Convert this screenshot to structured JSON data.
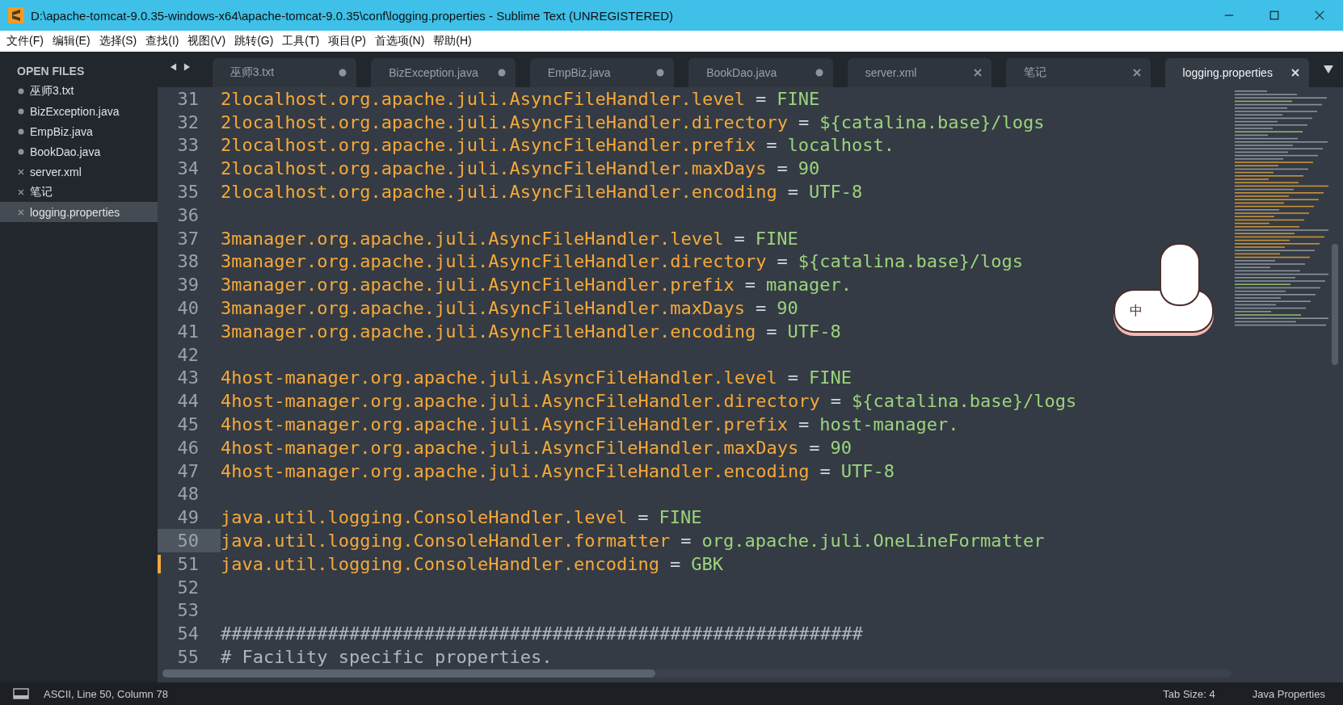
{
  "window": {
    "title": "D:\\apache-tomcat-9.0.35-windows-x64\\apache-tomcat-9.0.35\\conf\\logging.properties - Sublime Text (UNREGISTERED)"
  },
  "menu": [
    "文件(F)",
    "编辑(E)",
    "选择(S)",
    "查找(I)",
    "视图(V)",
    "跳转(G)",
    "工具(T)",
    "项目(P)",
    "首选项(N)",
    "帮助(H)"
  ],
  "sidebar": {
    "title": "OPEN FILES",
    "items": [
      {
        "label": "巫师3.txt",
        "dirty": true,
        "selected": false
      },
      {
        "label": "BizException.java",
        "dirty": true,
        "selected": false
      },
      {
        "label": "EmpBiz.java",
        "dirty": true,
        "selected": false
      },
      {
        "label": "BookDao.java",
        "dirty": true,
        "selected": false
      },
      {
        "label": "server.xml",
        "dirty": false,
        "selected": false
      },
      {
        "label": "笔记",
        "dirty": false,
        "selected": false
      },
      {
        "label": "logging.properties",
        "dirty": false,
        "selected": true
      }
    ]
  },
  "tabs": [
    {
      "label": "巫师3.txt",
      "dirty": true,
      "selected": false
    },
    {
      "label": "BizException.java",
      "dirty": true,
      "selected": false
    },
    {
      "label": "EmpBiz.java",
      "dirty": true,
      "selected": false
    },
    {
      "label": "BookDao.java",
      "dirty": true,
      "selected": false
    },
    {
      "label": "server.xml",
      "dirty": false,
      "selected": false
    },
    {
      "label": "笔记",
      "dirty": false,
      "selected": false
    },
    {
      "label": "logging.properties",
      "dirty": false,
      "selected": true
    }
  ],
  "editor": {
    "lines": [
      {
        "number": "31",
        "kind": "property",
        "key": "2localhost.org.apache.juli.AsyncFileHandler.level",
        "separator": "=",
        "value": "FINE",
        "current": false,
        "modified": false
      },
      {
        "number": "32",
        "kind": "property",
        "key": "2localhost.org.apache.juli.AsyncFileHandler.directory",
        "separator": "=",
        "value": "${catalina.base}/logs",
        "current": false,
        "modified": false
      },
      {
        "number": "33",
        "kind": "property",
        "key": "2localhost.org.apache.juli.AsyncFileHandler.prefix",
        "separator": "=",
        "value": "localhost.",
        "current": false,
        "modified": false
      },
      {
        "number": "34",
        "kind": "property",
        "key": "2localhost.org.apache.juli.AsyncFileHandler.maxDays",
        "separator": "=",
        "value": "90",
        "current": false,
        "modified": false
      },
      {
        "number": "35",
        "kind": "property",
        "key": "2localhost.org.apache.juli.AsyncFileHandler.encoding",
        "separator": "=",
        "value": "UTF-8",
        "current": false,
        "modified": false
      },
      {
        "number": "36",
        "kind": "blank",
        "current": false,
        "modified": false
      },
      {
        "number": "37",
        "kind": "property",
        "key": "3manager.org.apache.juli.AsyncFileHandler.level",
        "separator": "=",
        "value": "FINE",
        "current": false,
        "modified": false
      },
      {
        "number": "38",
        "kind": "property",
        "key": "3manager.org.apache.juli.AsyncFileHandler.directory",
        "separator": "=",
        "value": "${catalina.base}/logs",
        "current": false,
        "modified": false
      },
      {
        "number": "39",
        "kind": "property",
        "key": "3manager.org.apache.juli.AsyncFileHandler.prefix",
        "separator": "=",
        "value": "manager.",
        "current": false,
        "modified": false
      },
      {
        "number": "40",
        "kind": "property",
        "key": "3manager.org.apache.juli.AsyncFileHandler.maxDays",
        "separator": "=",
        "value": "90",
        "current": false,
        "modified": false
      },
      {
        "number": "41",
        "kind": "property",
        "key": "3manager.org.apache.juli.AsyncFileHandler.encoding",
        "separator": "=",
        "value": "UTF-8",
        "current": false,
        "modified": false
      },
      {
        "number": "42",
        "kind": "blank",
        "current": false,
        "modified": false
      },
      {
        "number": "43",
        "kind": "property",
        "key": "4host-manager.org.apache.juli.AsyncFileHandler.level",
        "separator": "=",
        "value": "FINE",
        "current": false,
        "modified": false
      },
      {
        "number": "44",
        "kind": "property",
        "key": "4host-manager.org.apache.juli.AsyncFileHandler.directory",
        "separator": "=",
        "value": "${catalina.base}/logs",
        "current": false,
        "modified": false
      },
      {
        "number": "45",
        "kind": "property",
        "key": "4host-manager.org.apache.juli.AsyncFileHandler.prefix",
        "separator": "=",
        "value": "host-manager.",
        "current": false,
        "modified": false
      },
      {
        "number": "46",
        "kind": "property",
        "key": "4host-manager.org.apache.juli.AsyncFileHandler.maxDays",
        "separator": "=",
        "value": "90",
        "current": false,
        "modified": false
      },
      {
        "number": "47",
        "kind": "property",
        "key": "4host-manager.org.apache.juli.AsyncFileHandler.encoding",
        "separator": "=",
        "value": "UTF-8",
        "current": false,
        "modified": false
      },
      {
        "number": "48",
        "kind": "blank",
        "current": false,
        "modified": false
      },
      {
        "number": "49",
        "kind": "property",
        "key": "java.util.logging.ConsoleHandler.level",
        "separator": "=",
        "value": "FINE",
        "current": false,
        "modified": false
      },
      {
        "number": "50",
        "kind": "property",
        "key": "java.util.logging.ConsoleHandler.formatter",
        "separator": "=",
        "value": "org.apache.juli.OneLineFormatter",
        "current": true,
        "modified": false
      },
      {
        "number": "51",
        "kind": "property",
        "key": "java.util.logging.ConsoleHandler.encoding",
        "separator": "=",
        "value": "GBK",
        "current": false,
        "modified": true
      },
      {
        "number": "52",
        "kind": "blank",
        "current": false,
        "modified": false
      },
      {
        "number": "53",
        "kind": "blank",
        "current": false,
        "modified": false
      },
      {
        "number": "54",
        "kind": "comment",
        "text": "############################################################",
        "current": false,
        "modified": false
      },
      {
        "number": "55",
        "kind": "comment",
        "text": "# Facility specific properties.",
        "current": false,
        "modified": false
      }
    ]
  },
  "ime_indicator": {
    "label": "中"
  },
  "status_bar": {
    "position": "ASCII, Line 50, Column 78",
    "tab_size": "Tab Size: 4",
    "syntax": "Java Properties"
  }
}
